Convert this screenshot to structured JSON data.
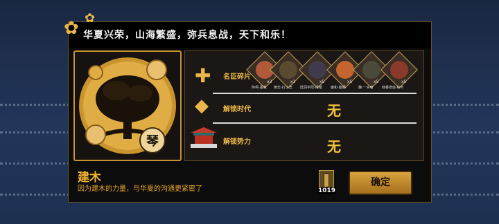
{
  "header": {
    "slogan": "华夏兴荣，山海繁盛，弥兵息战，天下和乐！"
  },
  "emblem": {
    "seal_glyph": "琴"
  },
  "rewards": {
    "fragments": {
      "label": "名臣碎片",
      "portraits": [
        {
          "name": "阿柯·墨苑",
          "count": "x3"
        },
        {
          "name": "黄忠·打斗笠",
          "count": "x1"
        },
        {
          "name": "陆羽字阳·绿帽",
          "count": "x5"
        },
        {
          "name": "秦和·秦朝",
          "count": "x5"
        },
        {
          "name": "魏·一言者",
          "count": "x5"
        },
        {
          "name": "桂香老班·红叶",
          "count": "x5"
        }
      ]
    },
    "era": {
      "label": "解锁时代",
      "value": "无"
    },
    "faction": {
      "label": "解锁势力",
      "value": "无"
    }
  },
  "detail": {
    "name": "建木",
    "description": "因为建木的力量，与华夏的沟通更紧密了"
  },
  "inventory": {
    "count": "1019"
  },
  "confirm_button": {
    "label": "确定"
  },
  "colors": {
    "gold": "#e8b64a",
    "panel": "#0c0c0c",
    "button": "#c28a30"
  }
}
